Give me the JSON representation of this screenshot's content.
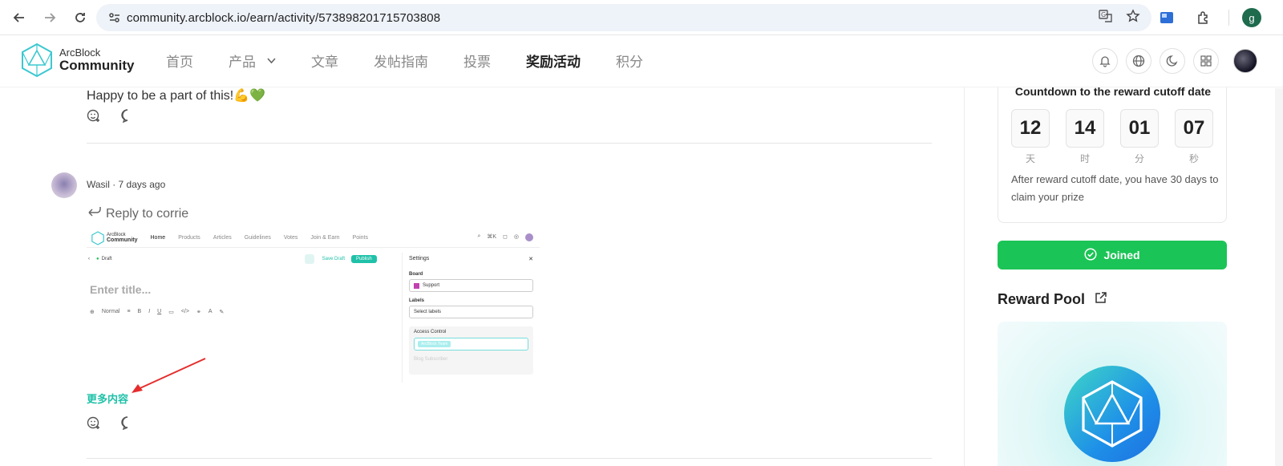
{
  "browser": {
    "url": "community.arcblock.io/earn/activity/573898201715703808",
    "profile_letter": "g",
    "icons": [
      "back-arrow-icon",
      "forward-arrow-icon",
      "reload-icon",
      "site-settings-icon",
      "translate-icon",
      "star-icon",
      "extension-icon",
      "puzzle-icon",
      "menu-dots-icon"
    ]
  },
  "site": {
    "logo_line1": "ArcBlock",
    "logo_line2": "Community",
    "menu": [
      {
        "label": "首页"
      },
      {
        "label": "产品"
      },
      {
        "label": "文章"
      },
      {
        "label": "发帖指南"
      },
      {
        "label": "投票"
      },
      {
        "label": "奖励活动"
      },
      {
        "label": "积分"
      }
    ],
    "active_menu": "奖励活动"
  },
  "feed": {
    "prev_comment_text": "Happy to be a part of this!💪💚",
    "comment": {
      "author": "Wasil",
      "meta": "Wasil · 7 days ago",
      "reply_to": "Reply to corrie",
      "more_link": "更多内容",
      "embed": {
        "logo1": "ArcBlock",
        "logo2": "Community",
        "menu": [
          "Home",
          "Products",
          "Articles",
          "Guidelines",
          "Votes",
          "Join & Earn",
          "Points"
        ],
        "shortcut": "⌘K",
        "draft": "Draft",
        "save_draft": "Save Draft",
        "publish": "Publish",
        "title_placeholder": "Enter title...",
        "normal": "Normal",
        "settings": "Settings",
        "board_label": "Board",
        "board_value": "Support",
        "labels_label": "Labels",
        "labels_placeholder": "Select labels",
        "access_label": "Access Control",
        "access_tag": "ArcBlock Team",
        "access_hint": "Blog Subscriber"
      }
    }
  },
  "sidebar": {
    "countdown_title": "Countdown to the reward cutoff date",
    "countdown": [
      {
        "value": "12",
        "unit": "天"
      },
      {
        "value": "14",
        "unit": "时"
      },
      {
        "value": "01",
        "unit": "分"
      },
      {
        "value": "07",
        "unit": "秒"
      }
    ],
    "note": "After reward cutoff date, you have 30 days to claim your prize",
    "joined_label": "Joined",
    "reward_pool_title": "Reward Pool"
  },
  "colors": {
    "accent_green": "#1bc456",
    "link_teal": "#1fc1a8"
  }
}
